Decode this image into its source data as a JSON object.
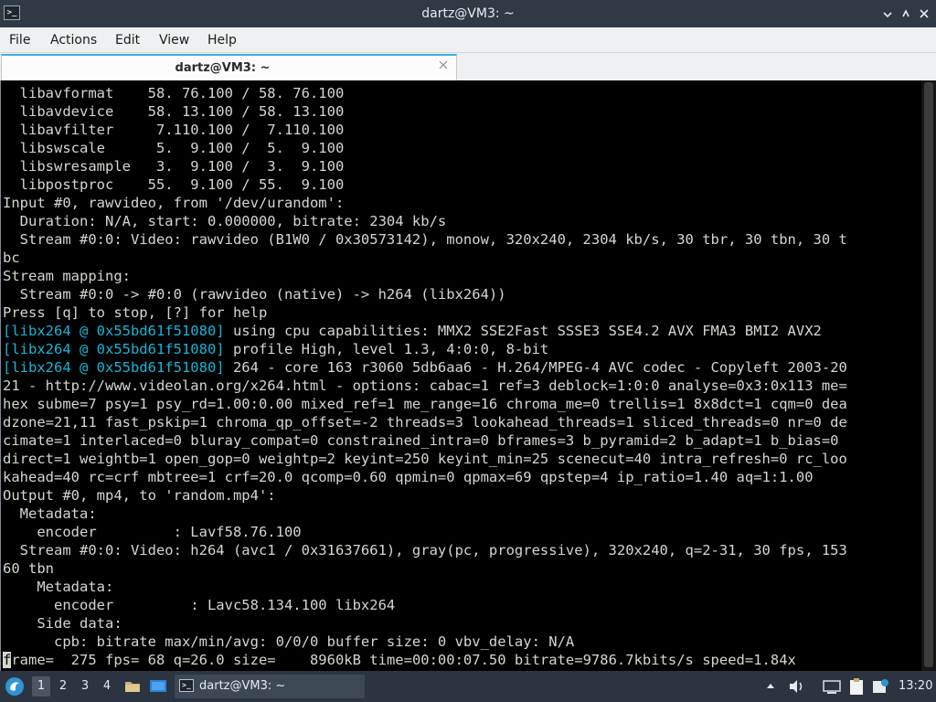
{
  "window": {
    "title": "dartz@VM3: ~",
    "icon_text": ">_"
  },
  "menu": [
    "File",
    "Actions",
    "Edit",
    "View",
    "Help"
  ],
  "tab": {
    "label": "dartz@VM3: ~"
  },
  "terminal": {
    "lines": [
      [
        {
          "t": "  libavformat    58. 76.100 / 58. 76.100"
        }
      ],
      [
        {
          "t": "  libavdevice    58. 13.100 / 58. 13.100"
        }
      ],
      [
        {
          "t": "  libavfilter     7.110.100 /  7.110.100"
        }
      ],
      [
        {
          "t": "  libswscale      5.  9.100 /  5.  9.100"
        }
      ],
      [
        {
          "t": "  libswresample   3.  9.100 /  3.  9.100"
        }
      ],
      [
        {
          "t": "  libpostproc    55.  9.100 / 55.  9.100"
        }
      ],
      [
        {
          "t": "Input #0, rawvideo, from '/dev/urandom':"
        }
      ],
      [
        {
          "t": "  Duration: N/A, start: 0.000000, bitrate: 2304 kb/s"
        }
      ],
      [
        {
          "t": "  Stream #0:0: Video: rawvideo (B1W0 / 0x30573142), monow, 320x240, 2304 kb/s, 30 tbr, 30 tbn, 30 t"
        }
      ],
      [
        {
          "t": "bc"
        }
      ],
      [
        {
          "t": "Stream mapping:"
        }
      ],
      [
        {
          "t": "  Stream #0:0 -> #0:0 (rawvideo (native) -> h264 (libx264))"
        }
      ],
      [
        {
          "t": "Press [q] to stop, [?] for help"
        }
      ],
      [
        {
          "t": "[libx264 @ 0x55bd61f51080]",
          "c": "tag"
        },
        {
          "t": " using cpu capabilities: MMX2 SSE2Fast SSSE3 SSE4.2 AVX FMA3 BMI2 AVX2"
        }
      ],
      [
        {
          "t": "[libx264 @ 0x55bd61f51080]",
          "c": "tag"
        },
        {
          "t": " profile High, level 1.3, 4:0:0, 8-bit"
        }
      ],
      [
        {
          "t": "[libx264 @ 0x55bd61f51080]",
          "c": "tag"
        },
        {
          "t": " 264 - core 163 r3060 5db6aa6 - H.264/MPEG-4 AVC codec - Copyleft 2003-20"
        }
      ],
      [
        {
          "t": "21 - http://www.videolan.org/x264.html - options: cabac=1 ref=3 deblock=1:0:0 analyse=0x3:0x113 me="
        }
      ],
      [
        {
          "t": "hex subme=7 psy=1 psy_rd=1.00:0.00 mixed_ref=1 me_range=16 chroma_me=0 trellis=1 8x8dct=1 cqm=0 dea"
        }
      ],
      [
        {
          "t": "dzone=21,11 fast_pskip=1 chroma_qp_offset=-2 threads=3 lookahead_threads=1 sliced_threads=0 nr=0 de"
        }
      ],
      [
        {
          "t": "cimate=1 interlaced=0 bluray_compat=0 constrained_intra=0 bframes=3 b_pyramid=2 b_adapt=1 b_bias=0"
        }
      ],
      [
        {
          "t": "direct=1 weightb=1 open_gop=0 weightp=2 keyint=250 keyint_min=25 scenecut=40 intra_refresh=0 rc_loo"
        }
      ],
      [
        {
          "t": "kahead=40 rc=crf mbtree=1 crf=20.0 qcomp=0.60 qpmin=0 qpmax=69 qpstep=4 ip_ratio=1.40 aq=1:1.00"
        }
      ],
      [
        {
          "t": "Output #0, mp4, to 'random.mp4':"
        }
      ],
      [
        {
          "t": "  Metadata:"
        }
      ],
      [
        {
          "t": "    encoder         : Lavf58.76.100"
        }
      ],
      [
        {
          "t": "  Stream #0:0: Video: h264 (avc1 / 0x31637661), gray(pc, progressive), 320x240, q=2-31, 30 fps, 153"
        }
      ],
      [
        {
          "t": "60 tbn"
        }
      ],
      [
        {
          "t": "    Metadata:"
        }
      ],
      [
        {
          "t": "      encoder         : Lavc58.134.100 libx264"
        }
      ],
      [
        {
          "t": "    Side data:"
        }
      ],
      [
        {
          "t": "      cpb: bitrate max/min/avg: 0/0/0 buffer size: 0 vbv_delay: N/A"
        }
      ],
      [
        {
          "t": "f",
          "c": "cursor"
        },
        {
          "t": "rame=  275 fps= 68 q=26.0 size=    8960kB time=00:00:07.50 bitrate=9786.7kbits/s speed=1.84x"
        }
      ]
    ]
  },
  "taskbar": {
    "workspaces": [
      "1",
      "2",
      "3",
      "4"
    ],
    "active_workspace": "1",
    "task": {
      "label": "dartz@VM3: ~",
      "icon_text": ">_"
    },
    "clock": "13:20"
  }
}
